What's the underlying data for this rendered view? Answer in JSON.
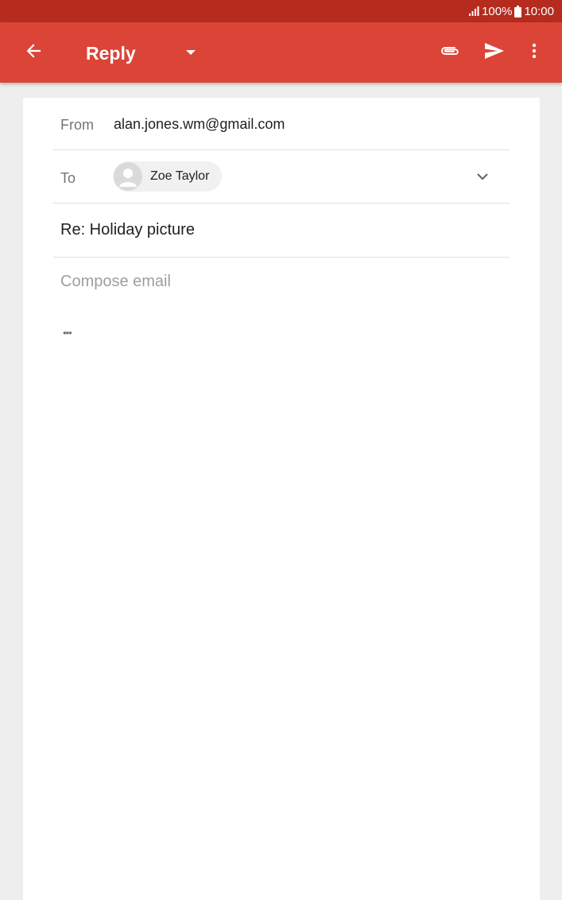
{
  "status_bar": {
    "battery": "100%",
    "time": "10:00",
    "icons": [
      "signal-icon",
      "battery-icon"
    ]
  },
  "app_bar": {
    "title": "Reply",
    "icons": [
      "back-arrow-icon",
      "dropdown-arrow-icon",
      "paperclip-icon",
      "send-icon",
      "more-vert-icon"
    ],
    "colors": {
      "app_bar": "#db4437",
      "status_bar": "#b52c1f"
    }
  },
  "compose": {
    "from_label": "From",
    "from_value": "alan.jones.wm@gmail.com",
    "to_label": "To",
    "recipient_name": "Zoe Taylor",
    "subject": "Re: Holiday picture",
    "body_placeholder": "Compose email",
    "quoted_text_toggle": "•••"
  }
}
